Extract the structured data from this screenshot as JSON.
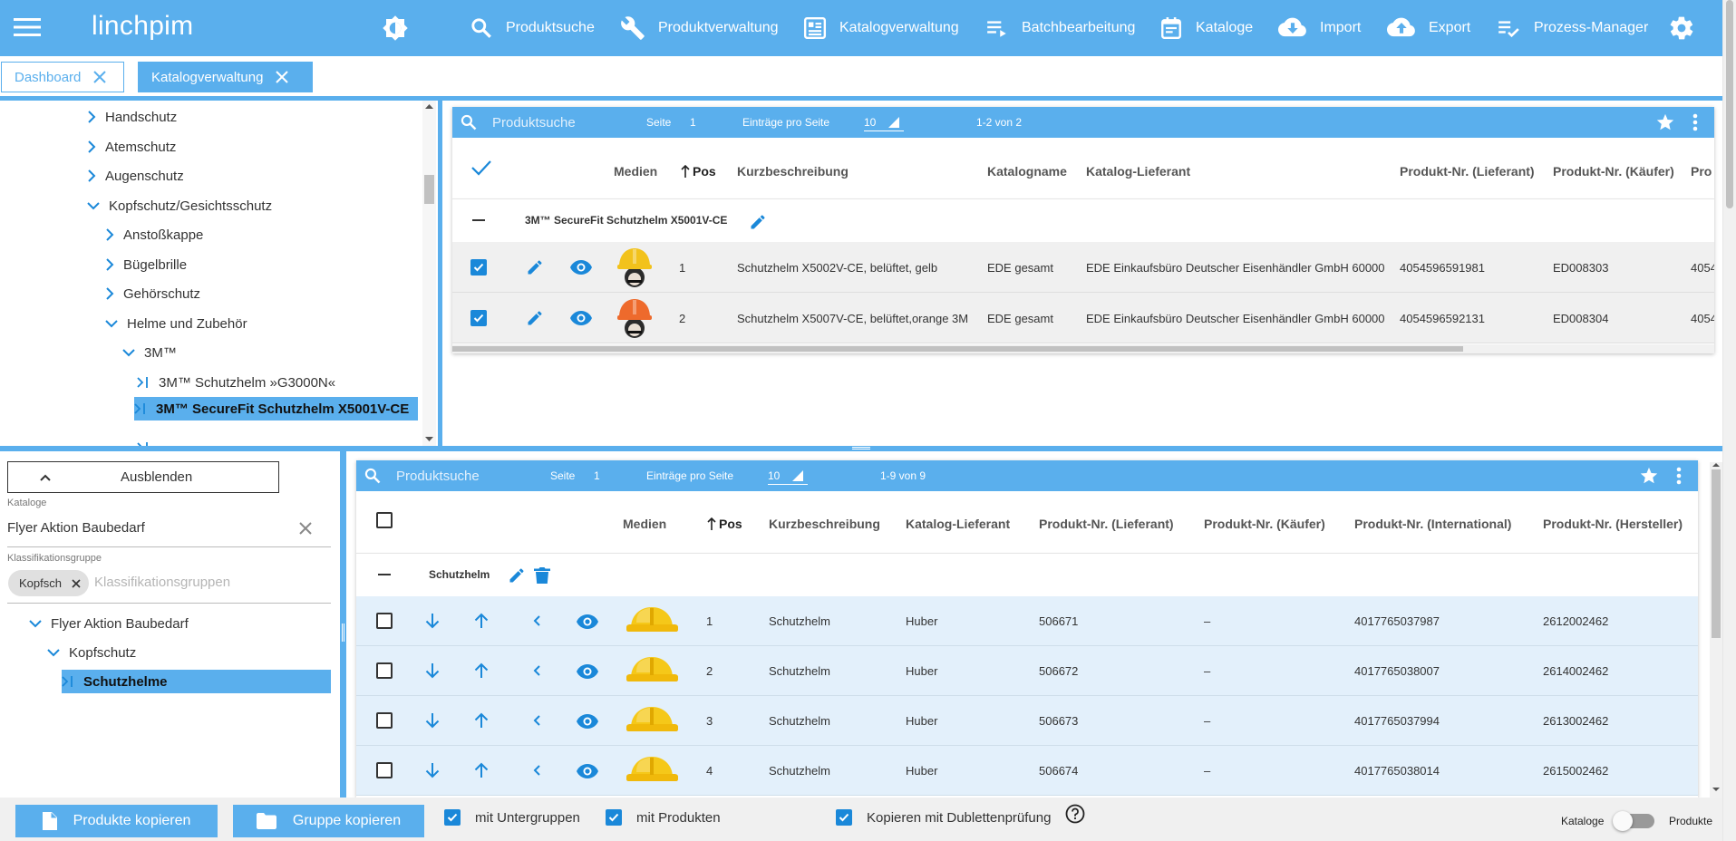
{
  "app": {
    "logo": "linchpim"
  },
  "nav": [
    {
      "label": "Produktsuche",
      "icon": "search-icon"
    },
    {
      "label": "Produktverwaltung",
      "icon": "wrench-icon"
    },
    {
      "label": "Katalogverwaltung",
      "icon": "catalog-icon"
    },
    {
      "label": "Batchbearbeitung",
      "icon": "batch-icon"
    },
    {
      "label": "Kataloge",
      "icon": "calendar-icon"
    },
    {
      "label": "Import",
      "icon": "cloud-download-icon"
    },
    {
      "label": "Export",
      "icon": "cloud-upload-icon"
    },
    {
      "label": "Prozess-Manager",
      "icon": "checklist-icon"
    }
  ],
  "tabs": [
    {
      "label": "Dashboard",
      "active": false
    },
    {
      "label": "Katalogverwaltung",
      "active": true
    }
  ],
  "tree_top": {
    "items": [
      {
        "label": "Handschutz",
        "state": "collapsed"
      },
      {
        "label": "Atemschutz",
        "state": "collapsed"
      },
      {
        "label": "Augenschutz",
        "state": "collapsed"
      },
      {
        "label": "Kopfschutz/Gesichtsschutz",
        "state": "expanded"
      },
      {
        "label": "Anstoßkappe",
        "state": "collapsed"
      },
      {
        "label": "Bügelbrille",
        "state": "collapsed"
      },
      {
        "label": "Gehörschutz",
        "state": "collapsed"
      },
      {
        "label": "Helme und Zubehör",
        "state": "expanded"
      },
      {
        "label": "3M™",
        "state": "expanded"
      },
      {
        "label": "3M™ Schutzhelm »G3000N«",
        "state": "leaf"
      },
      {
        "label": "3M™ SecureFit Schutzhelm X5001V-CE",
        "state": "leaf-selected"
      }
    ]
  },
  "grid_top": {
    "search_placeholder": "Produktsuche",
    "page_label": "Seite",
    "page": "1",
    "per_page_label": "Einträge pro Seite",
    "per_page": "10",
    "range": "1-2 von 2",
    "headers": [
      "Medien",
      "Pos",
      "Kurzbeschreibung",
      "Katalogname",
      "Katalog-Lieferant",
      "Produkt-Nr. (Lieferant)",
      "Produkt-Nr. (Käufer)",
      "Pro"
    ],
    "group_label": "3M™ SecureFit Schutzhelm X5001V-CE",
    "rows": [
      {
        "pos": "1",
        "desc": "Schutzhelm X5002V-CE, belüftet, gelb",
        "catalog": "EDE gesamt",
        "supplier": "EDE Einkaufsbüro Deutscher Eisenhändler GmbH 60000",
        "nr_supplier": "4054596591981",
        "nr_buyer": "ED008303",
        "more": "4054",
        "helmet_color": "#f2c21b"
      },
      {
        "pos": "2",
        "desc": "Schutzhelm X5007V-CE, belüftet,orange 3M",
        "catalog": "EDE gesamt",
        "supplier": "EDE Einkaufsbüro Deutscher Eisenhändler GmbH 60000",
        "nr_supplier": "4054596592131",
        "nr_buyer": "ED008304",
        "more": "4054",
        "helmet_color": "#ee6a2c"
      }
    ]
  },
  "left_bottom": {
    "hide_button": "Ausblenden",
    "catalog_label": "Kataloge",
    "catalog_value": "Flyer Aktion Baubedarf",
    "class_label": "Klassifikationsgruppe",
    "chip": "Kopfsch",
    "class_placeholder": "Klassifikationsgruppen",
    "tree": [
      {
        "label": "Flyer Aktion Baubedarf",
        "state": "expanded"
      },
      {
        "label": "Kopfschutz",
        "state": "expanded"
      },
      {
        "label": "Schutzhelme",
        "state": "leaf-selected"
      }
    ]
  },
  "grid_bottom": {
    "search_placeholder": "Produktsuche",
    "page_label": "Seite",
    "page": "1",
    "per_page_label": "Einträge pro Seite",
    "per_page": "10",
    "range": "1-9 von 9",
    "headers": [
      "Medien",
      "Pos",
      "Kurzbeschreibung",
      "Katalog-Lieferant",
      "Produkt-Nr. (Lieferant)",
      "Produkt-Nr. (Käufer)",
      "Produkt-Nr. (International)",
      "Produkt-Nr. (Hersteller)"
    ],
    "group_label": "Schutzhelm",
    "rows": [
      {
        "pos": "1",
        "desc": "Schutzhelm",
        "supplier": "Huber",
        "nr_supplier": "506671",
        "nr_buyer": "–",
        "nr_int": "4017765037987",
        "nr_man": "2612002462"
      },
      {
        "pos": "2",
        "desc": "Schutzhelm",
        "supplier": "Huber",
        "nr_supplier": "506672",
        "nr_buyer": "–",
        "nr_int": "4017765038007",
        "nr_man": "2614002462"
      },
      {
        "pos": "3",
        "desc": "Schutzhelm",
        "supplier": "Huber",
        "nr_supplier": "506673",
        "nr_buyer": "–",
        "nr_int": "4017765037994",
        "nr_man": "2613002462"
      },
      {
        "pos": "4",
        "desc": "Schutzhelm",
        "supplier": "Huber",
        "nr_supplier": "506674",
        "nr_buyer": "–",
        "nr_int": "4017765038014",
        "nr_man": "2615002462"
      }
    ]
  },
  "footer": {
    "copy_products": "Produkte kopieren",
    "copy_group": "Gruppe kopieren",
    "with_subgroups": "mit Untergruppen",
    "with_products": "mit Produkten",
    "copy_duplicates": "Kopieren mit Dublettenprüfung",
    "toggle_left": "Kataloge",
    "toggle_right": "Produkte"
  },
  "colors": {
    "accent": "#5aafed",
    "checkbox": "#1a88d9",
    "icon_blue": "#1a88d9"
  }
}
